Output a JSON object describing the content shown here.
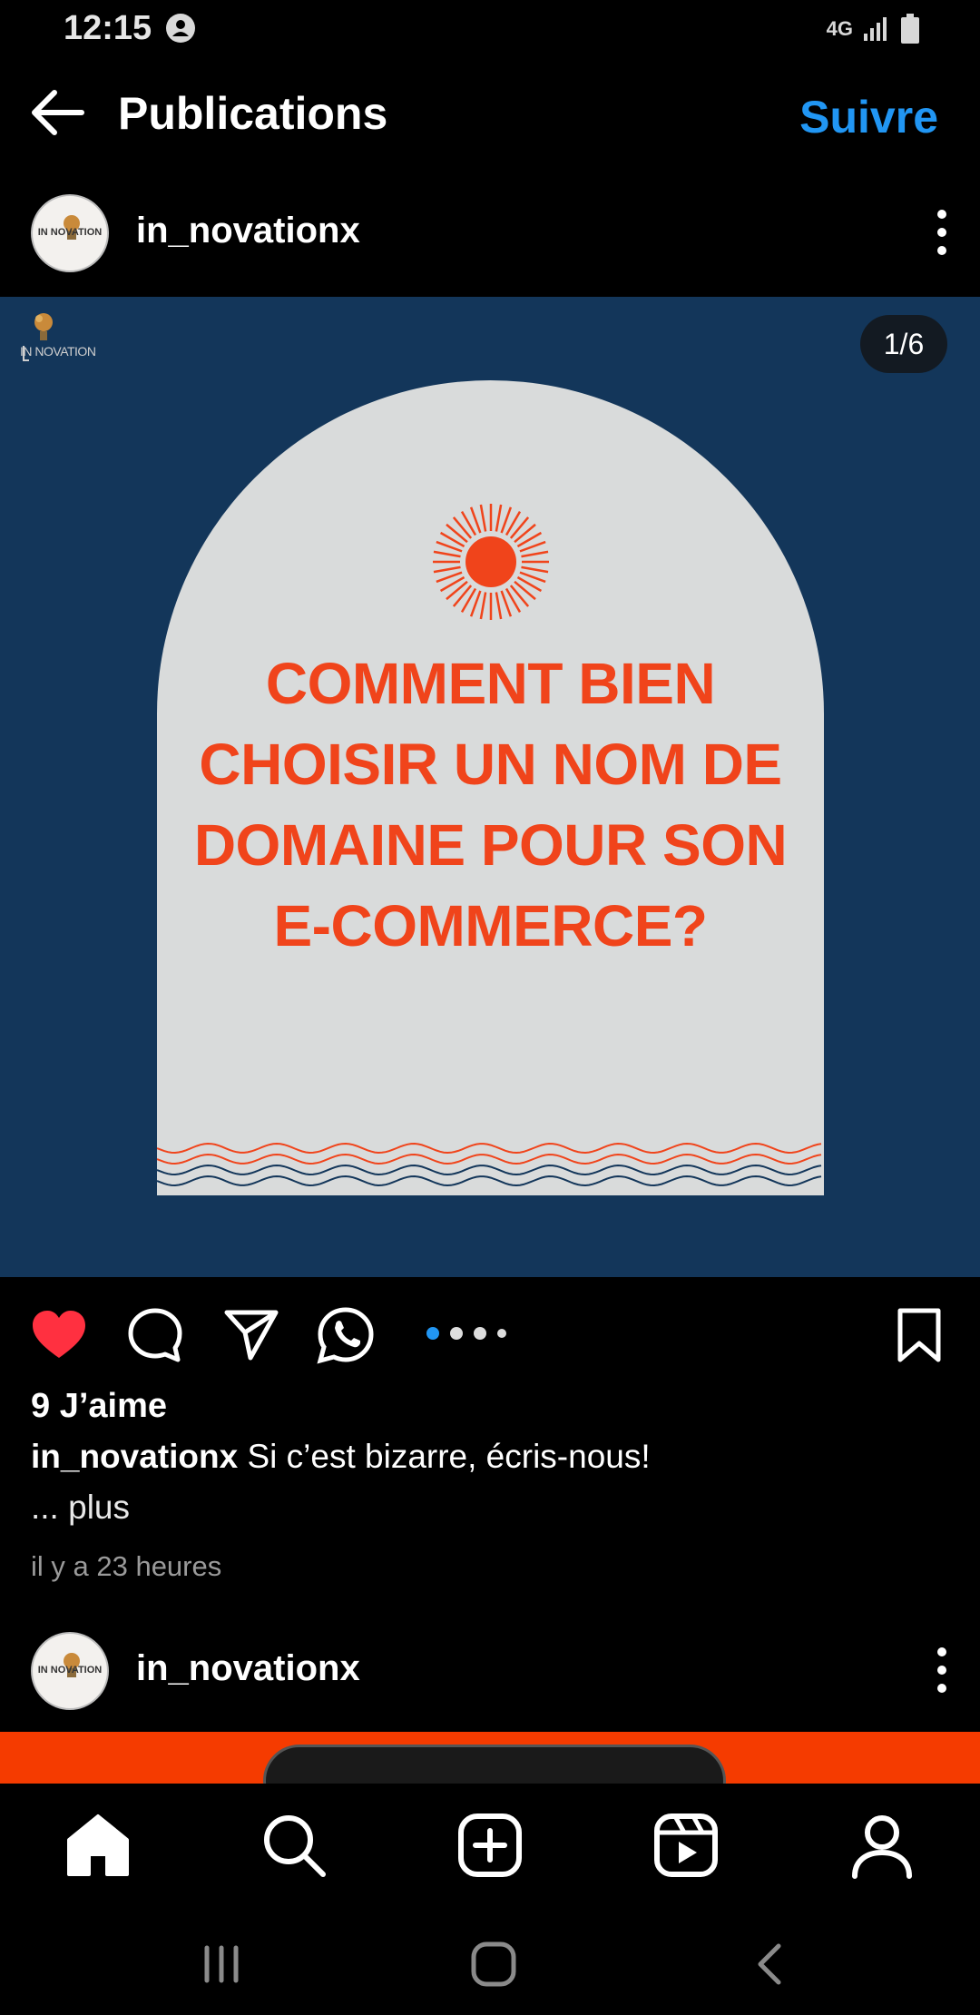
{
  "status_bar": {
    "time": "12:15",
    "network": "4G"
  },
  "header": {
    "title": "Publications",
    "follow_label": "Suivre"
  },
  "posts": [
    {
      "username": "in_novationx",
      "avatar_text": "IN NOVATION"
    },
    {
      "username": "in_novationx",
      "avatar_text": "IN NOVATION"
    }
  ],
  "post_image": {
    "brand": "IN NOVATION",
    "counter": "1/6",
    "headline": [
      "COMMENT BIEN",
      "CHOISIR UN NOM DE",
      "DOMAINE POUR SON",
      "E-COMMERCE?"
    ],
    "headline_color": "#f0441b",
    "background_color": "#13365a",
    "arch_color": "#d9dbdb"
  },
  "actions": {
    "liked": true,
    "like_icon": "heart-filled-icon",
    "comment_icon": "comment-icon",
    "share_icon": "send-icon",
    "whatsapp_icon": "whatsapp-icon",
    "save_icon": "bookmark-icon"
  },
  "likes": "9 J’aime",
  "caption": {
    "username": "in_novationx",
    "text": "Si c’est bizarre, écris-nous!"
  },
  "more_label": "... plus",
  "timestamp": "il y a 23 heures",
  "accent_color": "#2196f3",
  "like_color": "#ff3040",
  "bottom_nav": [
    "home-icon",
    "search-icon",
    "create-icon",
    "reels-icon",
    "profile-icon"
  ]
}
